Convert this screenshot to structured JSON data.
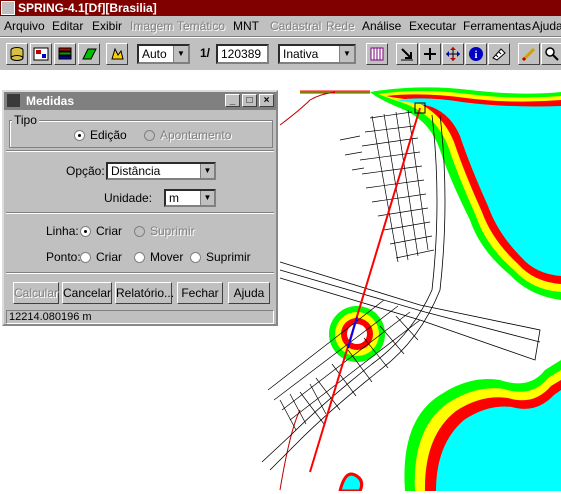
{
  "window": {
    "title": "SPRING-4.1[Df][Brasilia]"
  },
  "menu": [
    {
      "label": "Arquivo",
      "enabled": true
    },
    {
      "label": "Editar",
      "enabled": true
    },
    {
      "label": "Exibir",
      "enabled": true
    },
    {
      "label": "Imagem",
      "enabled": false
    },
    {
      "label": "Temático",
      "enabled": false
    },
    {
      "label": "MNT",
      "enabled": true
    },
    {
      "label": "Cadastral",
      "enabled": false
    },
    {
      "label": "Rede",
      "enabled": false
    },
    {
      "label": "Análise",
      "enabled": true
    },
    {
      "label": "Executar",
      "enabled": true
    },
    {
      "label": "Ferramentas",
      "enabled": true
    },
    {
      "label": "Ajuda",
      "enabled": true
    }
  ],
  "toolbar": {
    "zoom_mode": "Auto",
    "scale_prefix": "1/",
    "scale_value": "120389",
    "state": "Inativa"
  },
  "dialog": {
    "title": "Medidas",
    "tipo_label": "Tipo",
    "tipo_edicao": "Edição",
    "tipo_apontamento": "Apontamento",
    "opcao_label": "Opção:",
    "opcao_value": "Distância",
    "unidade_label": "Unidade:",
    "unidade_value": "m",
    "linha_label": "Linha:",
    "linha_criar": "Criar",
    "linha_suprimir": "Suprimir",
    "ponto_label": "Ponto:",
    "ponto_criar": "Criar",
    "ponto_mover": "Mover",
    "ponto_suprimir": "Suprimir",
    "btn_calcular": "Calcular",
    "btn_cancelar": "Cancelar",
    "btn_relatorio": "Relatório...",
    "btn_fechar": "Fechar",
    "btn_ajuda": "Ajuda",
    "result": "12214.080196 m"
  },
  "colors": {
    "title_active": "#800000",
    "title_inactive": "#808080",
    "water": "#00ffff",
    "buffer_green": "#00ff00",
    "buffer_yellow": "#ffff00",
    "buffer_red": "#ff0000",
    "measure_line": "#ff0000",
    "measure_line_partial": "#0000ff"
  }
}
